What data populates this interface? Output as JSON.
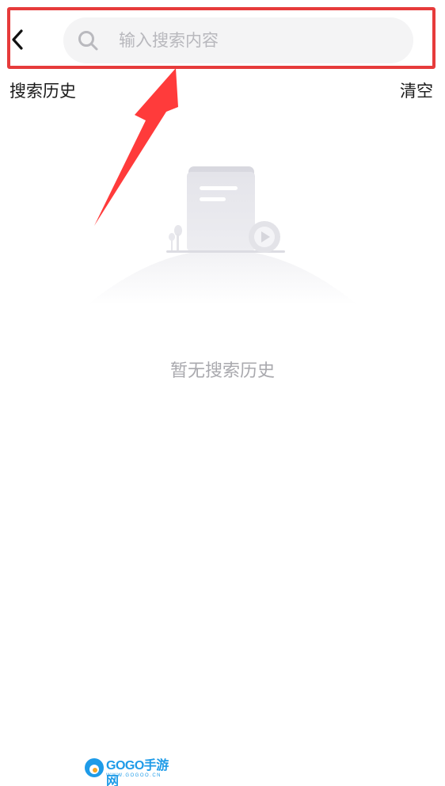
{
  "header": {
    "back_icon": "chevron-left-icon",
    "search": {
      "icon": "search-icon",
      "placeholder": "输入搜索内容",
      "value": ""
    }
  },
  "history": {
    "title": "搜索历史",
    "clear_label": "清空"
  },
  "empty_state": {
    "illustration": "empty-document-video-illustration",
    "message": "暂无搜索历史"
  },
  "annotation": {
    "frame_color": "#e63b3b",
    "arrow_color": "#ff3b3b"
  },
  "watermark": {
    "brand": "GOGO手游网",
    "url": "WWW.GOGOO.CN"
  }
}
